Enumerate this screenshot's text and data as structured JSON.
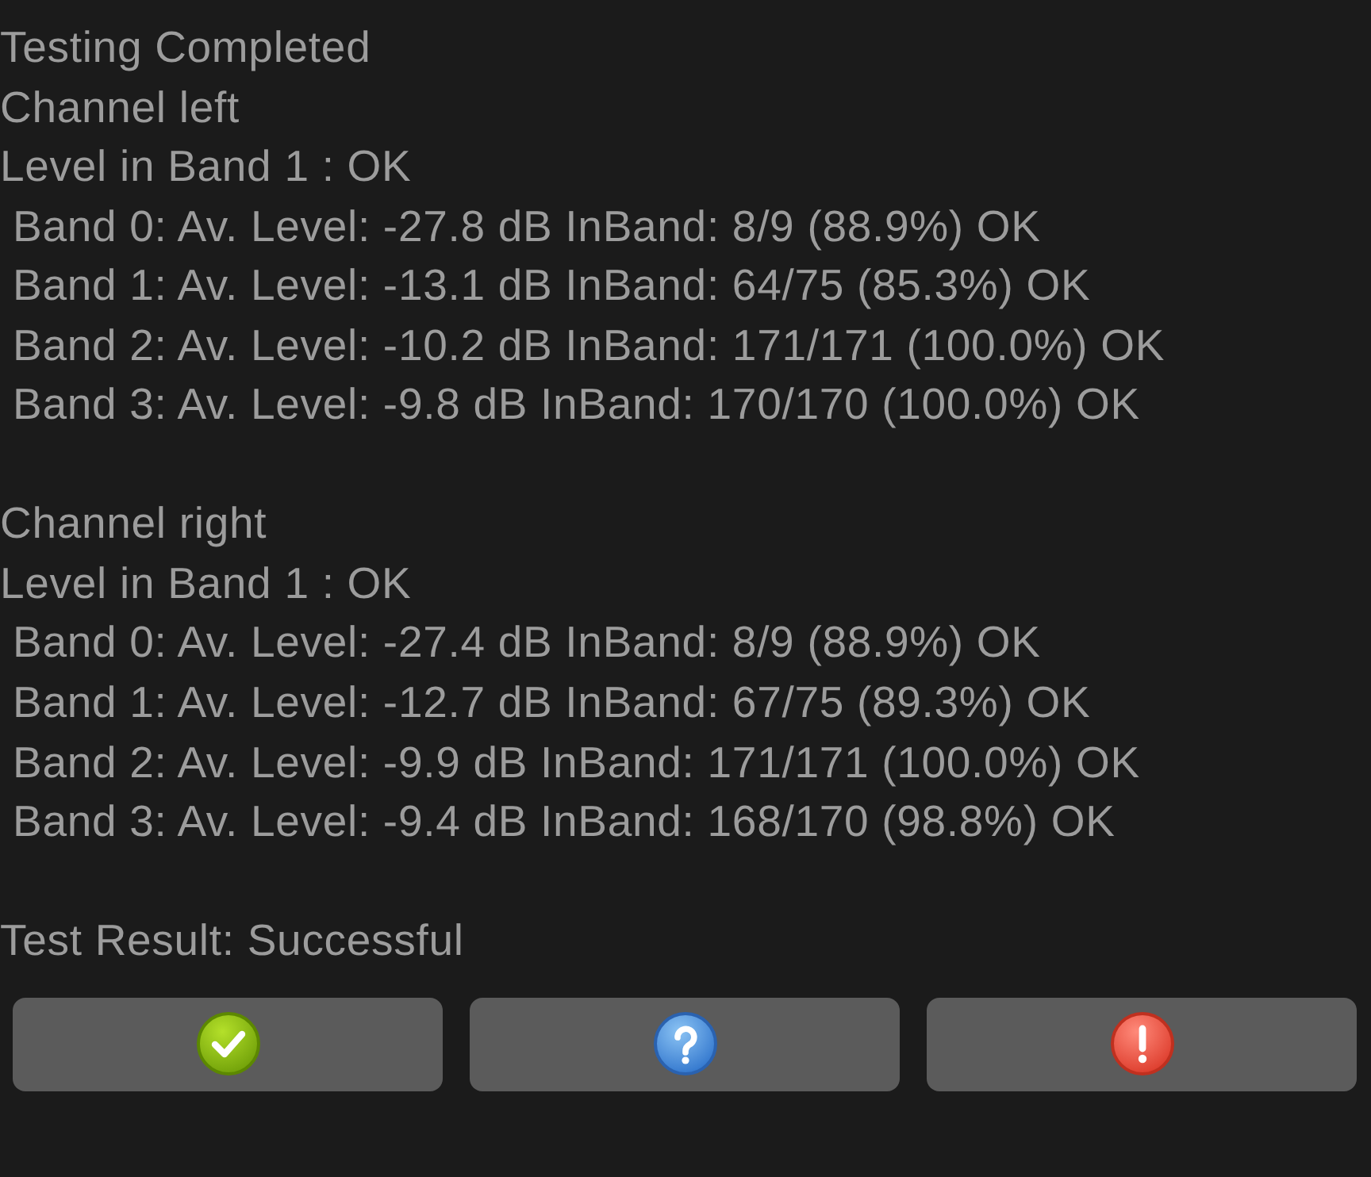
{
  "report": {
    "status": "Testing Completed",
    "channels": [
      {
        "name": "Channel left",
        "summary": "Level in Band 1 : OK",
        "bands": [
          "Band 0: Av. Level: -27.8 dB InBand: 8/9 (88.9%) OK",
          "Band 1: Av. Level: -13.1 dB InBand: 64/75 (85.3%) OK",
          "Band 2: Av. Level: -10.2 dB InBand: 171/171 (100.0%) OK",
          "Band 3: Av. Level: -9.8 dB InBand: 170/170 (100.0%) OK"
        ]
      },
      {
        "name": "Channel right",
        "summary": "Level in Band 1 : OK",
        "bands": [
          "Band 0: Av. Level: -27.4 dB InBand: 8/9 (88.9%) OK",
          "Band 1: Av. Level: -12.7 dB InBand: 67/75 (89.3%) OK",
          "Band 2: Av. Level: -9.9 dB InBand: 171/171 (100.0%) OK",
          "Band 3: Av. Level: -9.4 dB InBand: 168/170 (98.8%) OK"
        ]
      }
    ],
    "result": "Test Result: Successful"
  },
  "buttons": [
    {
      "kind": "pass"
    },
    {
      "kind": "info"
    },
    {
      "kind": "fail"
    }
  ]
}
